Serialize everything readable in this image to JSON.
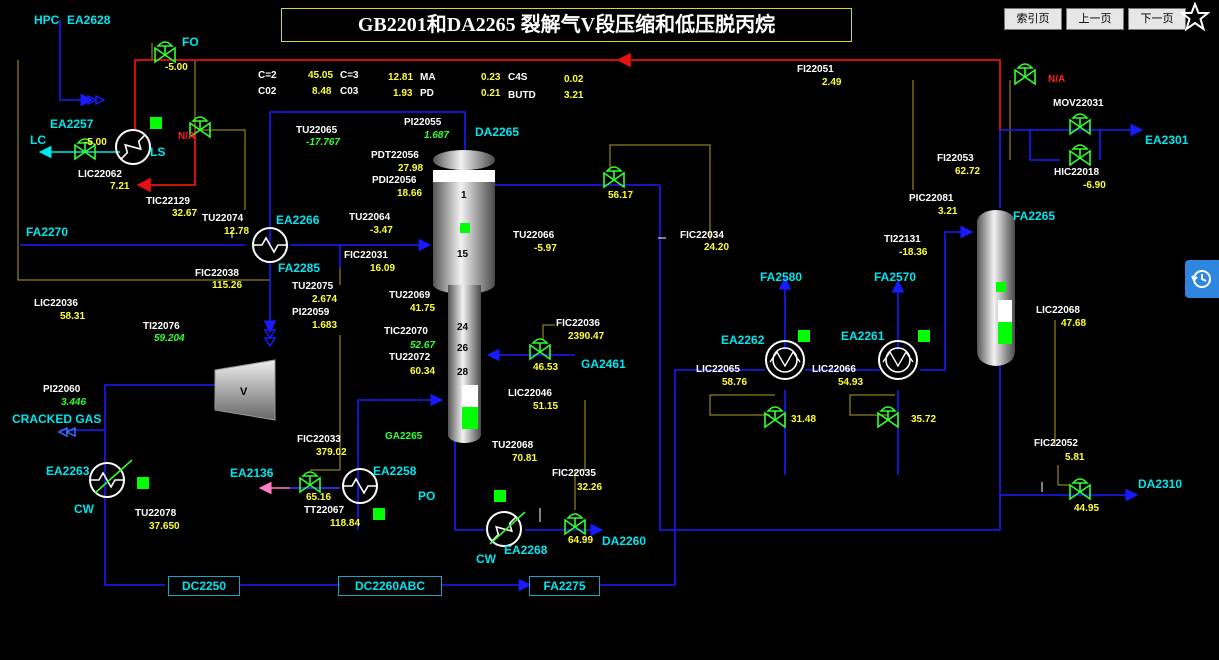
{
  "title": "GB2201和DA2265 裂解气V段压缩和低压脱丙烷",
  "nav": {
    "index": "索引页",
    "prev": "上一页",
    "next": "下一页"
  },
  "analysis": {
    "c2_eq": "C=2",
    "c2_eq_val": "45.05",
    "c3_eq": "C=3",
    "c3_eq_val": "12.81",
    "c2_sat": "C02",
    "c2_sat_val": "8.48",
    "c3_sat": "C03",
    "c3_sat_val": "1.93",
    "ma": "MA",
    "ma_val": "0.23",
    "pd": "PD",
    "pd_val": "0.21",
    "c4s": "C4S",
    "c4s_val": "0.02",
    "butd": "BUTD",
    "butd_val": "3.21"
  },
  "equipment": {
    "hpc": "HPC",
    "ea2628": "EA2628",
    "fo": "FO",
    "ea2257": "EA2257",
    "lc": "LC",
    "ls": "LS",
    "fa2270": "FA2270",
    "ea2266": "EA2266",
    "fa2285": "FA2285",
    "da2265": "DA2265",
    "cracked_gas": "CRACKED GAS",
    "ea2263": "EA2263",
    "cw1": "CW",
    "ea2136": "EA2136",
    "ea2258": "EA2258",
    "po": "PO",
    "ga2265": "GA2265",
    "ga2461": "GA2461",
    "ea2268": "EA2268",
    "cw2": "CW",
    "da2260": "DA2260",
    "dc2250": "DC2250",
    "dc2260abc": "DC2260ABC",
    "fa2275": "FA2275",
    "fa2580": "FA2580",
    "fa2570": "FA2570",
    "ea2262": "EA2262",
    "ea2261": "EA2261",
    "fa2265": "FA2265",
    "ea2301": "EA2301",
    "da2310": "DA2310",
    "compressor": "V",
    "na_top": "N/A",
    "na_left": "N/A"
  },
  "tags": {
    "fo_val": "-5.00",
    "lic22062": "LIC22062",
    "lic22062_v": "7.21",
    "lc_valve_val": "-5.00",
    "tic22129": "TIC22129",
    "tic22129_v": "32.67",
    "tu22074": "TU22074",
    "tu22074_v": "12.78",
    "tu22065": "TU22065",
    "tu22065_v": "-17.767",
    "tu22064": "TU22064",
    "tu22064_v": "-3.47",
    "fic22031": "FIC22031",
    "fic22031_v": "16.09",
    "fic22038": "FIC22038",
    "fic22038_v": "115.26",
    "tu22075": "TU22075",
    "tu22075_v": "2.674",
    "pi22059": "PI22059",
    "pi22059_v": "1.683",
    "lic22036": "LIC22036",
    "lic22036_v": "58.31",
    "ti22076": "TI22076",
    "ti22076_v": "59.204",
    "pi22060": "PI22060",
    "pi22060_v": "3.446",
    "tu22078": "TU22078",
    "tu22078_v": "37.650",
    "pi22055": "PI22055",
    "pi22055_v": "1.687",
    "pdt22056": "PDT22056",
    "pdt22056_v": "27.98",
    "pdi22056": "PDI22056",
    "pdi22056_v": "18.66",
    "tu22066": "TU22066",
    "tu22066_v": "-5.97",
    "tu22069": "TU22069",
    "tu22069_v": "41.75",
    "tic22070": "TIC22070",
    "tic22070_v": "52.67",
    "tu22072": "TU22072",
    "tu22072_v": "60.34",
    "fic22036": "FIC22036",
    "fic22036_v": "2390.47",
    "ga2461_valve_v": "46.53",
    "lic22046": "LIC22046",
    "lic22046_v": "51.15",
    "fic22033": "FIC22033",
    "fic22033_v": "379.02",
    "ea2136_valve_v": "65.16",
    "tt22067": "TT22067",
    "tt22067_v": "118.84",
    "tu22068": "TU22068",
    "tu22068_v": "70.81",
    "fic22035": "FIC22035",
    "fic22035_v": "32.26",
    "da2260_valve_v": "64.99",
    "fic22034_valve_v": "56.17",
    "fic22034": "FIC22034",
    "fic22034_v": "24.20",
    "fi22051": "FI22051",
    "fi22051_v": "2.49",
    "mov22031": "MOV22031",
    "fi22053": "FI22053",
    "fi22053_v": "62.72",
    "hic22018": "HIC22018",
    "hic22018_v": "-6.90",
    "pic22081": "PIC22081",
    "pic22081_v": "3.21",
    "ti22131": "TI22131",
    "ti22131_v": "-18.36",
    "lic22065": "LIC22065",
    "lic22065_v": "58.76",
    "ea2262_valve_v": "31.48",
    "lic22066": "LIC22066",
    "lic22066_v": "54.93",
    "ea2261_valve_v": "35.72",
    "lic22068": "LIC22068",
    "lic22068_v": "47.68",
    "fic22052": "FIC22052",
    "fic22052_v": "5.81",
    "da2310_valve_v": "44.95",
    "tray1": "1",
    "tray15": "15",
    "tray24": "24",
    "tray26": "26",
    "tray28": "28"
  },
  "colors": {
    "process": "#1a1aff",
    "red_line": "#e81010",
    "signal": "#b0a020",
    "cyan": "#00e5ee",
    "value": "#ffff33",
    "green_ind": "#00ff00"
  }
}
